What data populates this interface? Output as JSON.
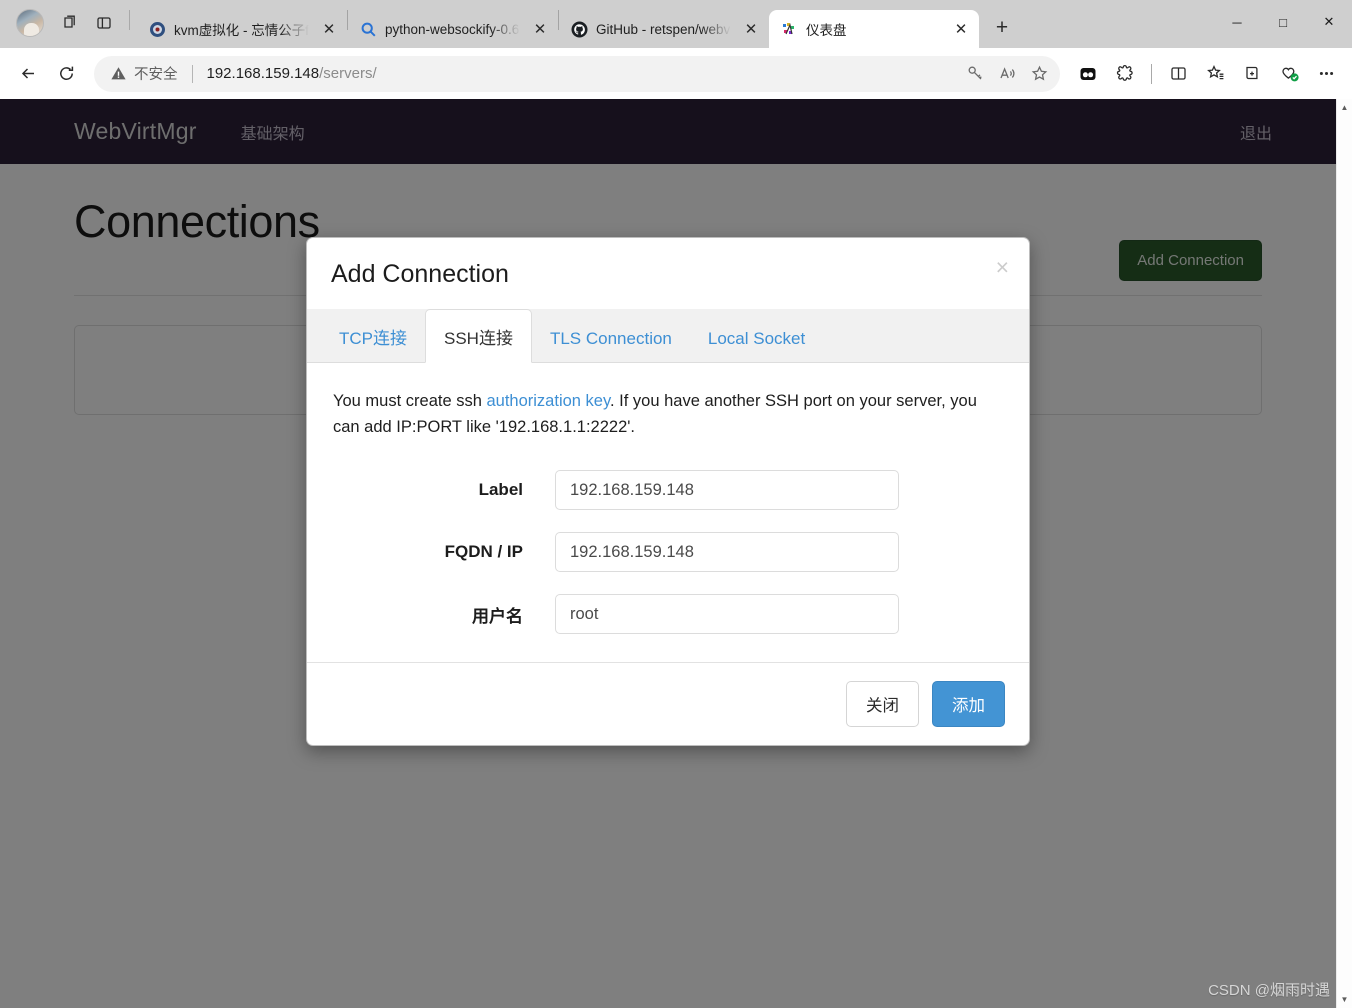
{
  "browser": {
    "profile_name": "profile-avatar",
    "tabs": [
      {
        "title": "kvm虚拟化 - 忘情公子f",
        "favicon": "kvm-favicon",
        "active": false
      },
      {
        "title": "python-websockify-0.6",
        "favicon": "search-favicon",
        "active": false
      },
      {
        "title": "GitHub - retspen/webv",
        "favicon": "github-favicon",
        "active": false
      },
      {
        "title": "仪表盘",
        "favicon": "webvirtmgr-favicon",
        "active": true
      }
    ],
    "new_tab_label": "+",
    "window_controls": {
      "minimize": "─",
      "maximize": "□",
      "close": "✕"
    },
    "toolbar": {
      "back": "←",
      "refresh": "⟳",
      "security_label": "不安全",
      "url_host": "192.168.159.148",
      "url_path": "/servers/",
      "omnibox_icons": [
        "key-icon",
        "read-aloud-icon",
        "favorite-star-icon"
      ],
      "right_icons": [
        "copilot-icon",
        "extensions-icon",
        "split-screen-icon",
        "favorites-icon",
        "collections-icon",
        "browser-essentials-icon",
        "settings-more-icon"
      ]
    }
  },
  "page": {
    "navbar": {
      "brand": "WebVirtMgr",
      "links": [
        "基础架构"
      ],
      "logout": "退出"
    },
    "title": "Connections",
    "add_connection_button": "Add Connection"
  },
  "modal": {
    "title": "Add Connection",
    "close_symbol": "×",
    "tabs": [
      {
        "label": "TCP连接",
        "active": false
      },
      {
        "label": "SSH连接",
        "active": true
      },
      {
        "label": "TLS Connection",
        "active": false
      },
      {
        "label": "Local Socket",
        "active": false
      }
    ],
    "help": {
      "part1": "You must create ssh ",
      "link": "authorization key",
      "part2": ". If you have another SSH port on your server, you can add IP:PORT like '192.168.1.1:2222'."
    },
    "fields": [
      {
        "label": "Label",
        "value": "192.168.159.148",
        "placeholder": ""
      },
      {
        "label": "FQDN / IP",
        "value": "192.168.159.148",
        "placeholder": ""
      },
      {
        "label": "用户名",
        "value": "root",
        "placeholder": ""
      }
    ],
    "buttons": {
      "close": "关闭",
      "submit": "添加"
    }
  },
  "watermark": "CSDN @烟雨时遇",
  "colors": {
    "navbar_bg": "#2d2039",
    "primary_button": "#4394d4",
    "add_connection_green": "#2b5a2b",
    "link_blue": "#3d8fd4"
  }
}
